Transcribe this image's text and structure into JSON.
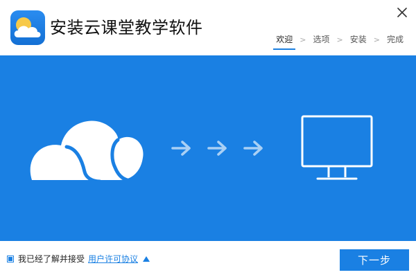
{
  "window": {
    "title": "安装云课堂教学软件"
  },
  "steps": [
    {
      "label": "欢迎",
      "active": true
    },
    {
      "label": "选项",
      "active": false
    },
    {
      "label": "安装",
      "active": false
    },
    {
      "label": "完成",
      "active": false
    }
  ],
  "step_separator": ">",
  "footer": {
    "agree_text": "我已经了解并接受",
    "license_link": "用户许可协议",
    "agree_checked": true,
    "next_button": "下一步"
  },
  "colors": {
    "brand_blue": "#1a80e3",
    "arrow_light": "#a9d0f5"
  },
  "icons": {
    "app": "cloud-sun-icon",
    "close": "close-icon",
    "banner_cloud": "cloud-icon",
    "banner_monitor": "monitor-icon",
    "license_toggle": "triangle-up-icon"
  }
}
